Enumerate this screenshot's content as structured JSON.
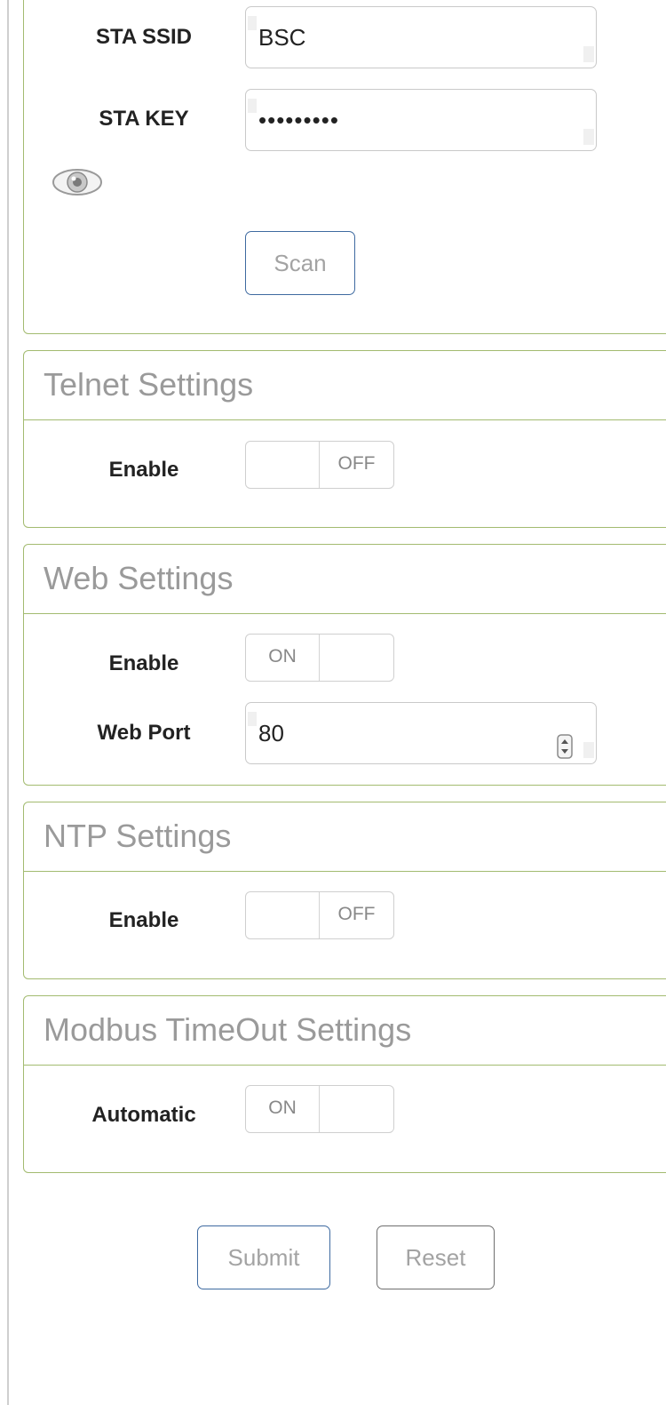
{
  "wifi": {
    "ssid_label": "STA SSID",
    "ssid_value": "BSC",
    "key_label": "STA KEY",
    "key_value": "•••••••••",
    "scan_label": "Scan"
  },
  "telnet": {
    "title": "Telnet Settings",
    "enable_label": "Enable",
    "toggle_text": "OFF",
    "state": "off"
  },
  "web": {
    "title": "Web Settings",
    "enable_label": "Enable",
    "toggle_text": "ON",
    "state": "on",
    "port_label": "Web Port",
    "port_value": "80"
  },
  "ntp": {
    "title": "NTP Settings",
    "enable_label": "Enable",
    "toggle_text": "OFF",
    "state": "off"
  },
  "modbus": {
    "title": "Modbus TimeOut Settings",
    "automatic_label": "Automatic",
    "toggle_text": "ON",
    "state": "on"
  },
  "actions": {
    "submit_label": "Submit",
    "reset_label": "Reset"
  },
  "colors": {
    "panel_border": "#a3bb70",
    "primary_button_border": "#3e6aa0",
    "secondary_button_border": "#6f6f6f"
  }
}
